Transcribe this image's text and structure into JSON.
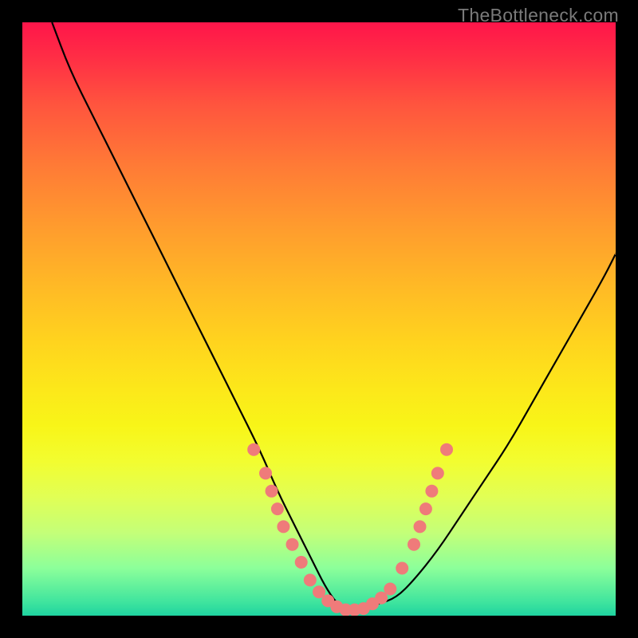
{
  "watermark": "TheBottleneck.com",
  "chart_data": {
    "type": "line",
    "title": "",
    "xlabel": "",
    "ylabel": "",
    "xlim": [
      0,
      100
    ],
    "ylim": [
      0,
      100
    ],
    "grid": false,
    "legend": false,
    "series": [
      {
        "name": "bottleneck-curve",
        "x": [
          5,
          8,
          12,
          16,
          20,
          24,
          28,
          32,
          36,
          40,
          43,
          46,
          49,
          51,
          53,
          55,
          57,
          60,
          63,
          66,
          70,
          74,
          78,
          82,
          86,
          90,
          94,
          98,
          100
        ],
        "y": [
          100,
          92,
          84,
          76,
          68,
          60,
          52,
          44,
          36,
          28,
          21,
          15,
          9,
          5,
          2,
          1,
          1,
          2,
          3,
          6,
          11,
          17,
          23,
          29,
          36,
          43,
          50,
          57,
          61
        ],
        "color": "#000000"
      }
    ],
    "highlight_points": {
      "name": "sample-dots",
      "color": "#ef7b7a",
      "points": [
        {
          "x": 39,
          "y": 28
        },
        {
          "x": 41,
          "y": 24
        },
        {
          "x": 42,
          "y": 21
        },
        {
          "x": 43,
          "y": 18
        },
        {
          "x": 44,
          "y": 15
        },
        {
          "x": 45.5,
          "y": 12
        },
        {
          "x": 47,
          "y": 9
        },
        {
          "x": 48.5,
          "y": 6
        },
        {
          "x": 50,
          "y": 4
        },
        {
          "x": 51.5,
          "y": 2.5
        },
        {
          "x": 53,
          "y": 1.5
        },
        {
          "x": 54.5,
          "y": 1
        },
        {
          "x": 56,
          "y": 1
        },
        {
          "x": 57.5,
          "y": 1.2
        },
        {
          "x": 59,
          "y": 2
        },
        {
          "x": 60.5,
          "y": 3
        },
        {
          "x": 62,
          "y": 4.5
        },
        {
          "x": 64,
          "y": 8
        },
        {
          "x": 66,
          "y": 12
        },
        {
          "x": 67,
          "y": 15
        },
        {
          "x": 68,
          "y": 18
        },
        {
          "x": 69,
          "y": 21
        },
        {
          "x": 70,
          "y": 24
        },
        {
          "x": 71.5,
          "y": 28
        }
      ]
    }
  }
}
